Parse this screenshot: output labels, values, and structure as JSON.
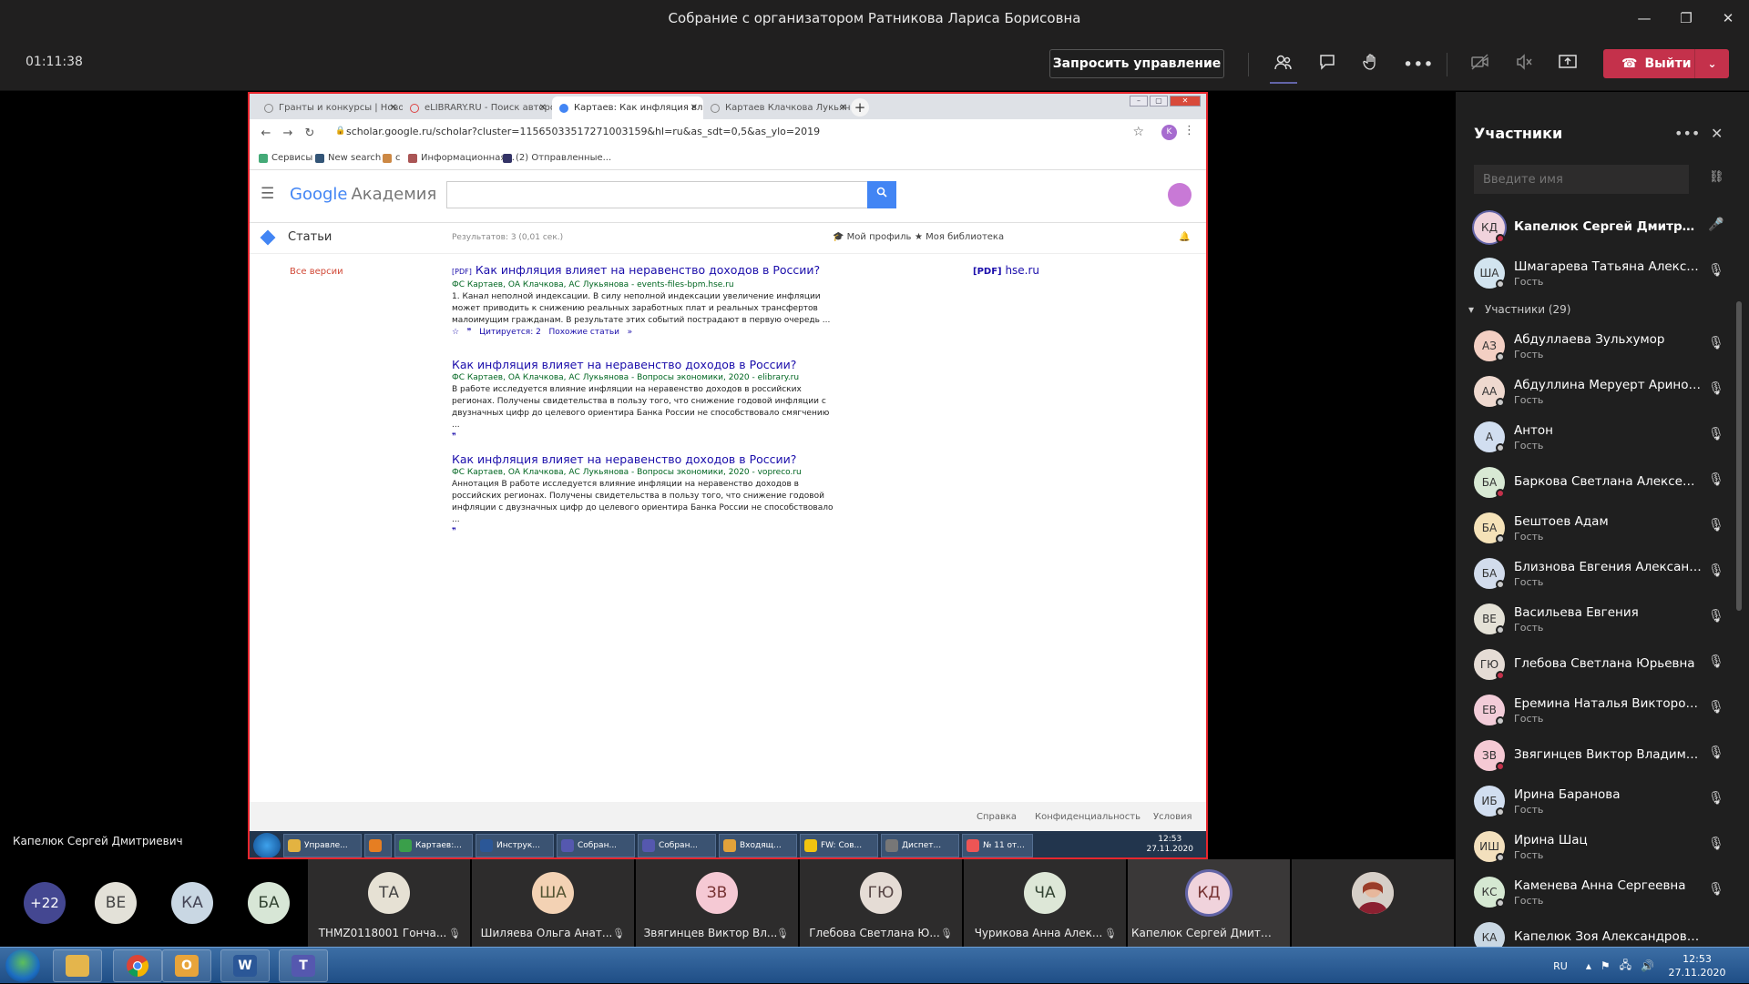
{
  "window": {
    "title": "Собрание с организатором Ратникова Лариса Борисовна",
    "min": "—",
    "max": "❐",
    "close": "✕"
  },
  "toolbar": {
    "timer": "01:11:38",
    "request_control": "Запросить управление",
    "leave_label": "Выйти"
  },
  "browser": {
    "tabs": [
      {
        "label": "Гранты и конкурсы | Новости"
      },
      {
        "label": "eLIBRARY.RU - Поиск авторов"
      },
      {
        "label": "Картаев: Как инфляция влияет"
      },
      {
        "label": "Картаев Клачкова Лукьянова р"
      }
    ],
    "url": "scholar.google.ru/scholar?cluster=11565033517271003159&hl=ru&as_sdt=0,5&as_ylo=2019",
    "profile_letter": "K",
    "bookmarks": [
      "Сервисы",
      "New search",
      "с",
      "Информационная...",
      "(2) Отправленные..."
    ]
  },
  "scholar": {
    "logo_g": "Google",
    "logo_suffix": "Академия",
    "search_value": "",
    "articles": "Статьи",
    "results_count": "Результатов: 3 (0,01 сек.)",
    "my_profile": "Мой профиль",
    "my_library": "Моя библиотека",
    "all_versions": "Все версии",
    "results": [
      {
        "tag": "[PDF]",
        "title": "Как инфляция влияет на неравенство доходов в России?",
        "authors": "ФС Картаев, ОА Клачкова, АС Лукьянова - events-files-bpm.hse.ru",
        "snippet1": "1. Канал неполной индексации. В силу неполной индексации увеличение инфляции",
        "snippet2": "может приводить к снижению реальных заработных плат и реальных трансфертов",
        "snippet3": "малоимущим гражданам. В результате этих событий пострадают в первую очередь ...",
        "cited": "Цитируется: 2",
        "related": "Похожие статьи"
      },
      {
        "title": "Как инфляция влияет на неравенство доходов в России?",
        "authors": "ФС Картаев, ОА Клачкова, АС Лукьянова - Вопросы экономики, 2020 - elibrary.ru",
        "snippet1": "В работе исследуется влияние инфляции на неравенство доходов в российских",
        "snippet2": "регионах. Получены свидетельства в пользу того, что снижение годовой инфляции с",
        "snippet3": "двузначных цифр до целевого ориентира Банка России не способствовало смягчению ..."
      },
      {
        "title": "Как инфляция влияет на неравенство доходов в России?",
        "authors": "ФС Картаев, ОА Клачкова, АС Лукьянова - Вопросы экономики, 2020 - vopreco.ru",
        "snippet1": "Аннотация В работе исследуется влияние инфляции на неравенство доходов в",
        "snippet2": "российских регионах. Получены свидетельства в пользу того, что снижение годовой",
        "snippet3": "инфляции с двузначных цифр до целевого ориентира Банка России не способствовало ..."
      }
    ],
    "pdf_side_tag": "[PDF]",
    "pdf_side_host": "hse.ru",
    "footer": [
      "Справка",
      "Конфиденциальность",
      "Условия"
    ]
  },
  "inner_taskbar": {
    "items": [
      "Управле...",
      "",
      "Картаев:...",
      "Инструк...",
      "Собран...",
      "Собран...",
      "Входящ...",
      "FW: Сов...",
      "Диспет...",
      "№ 11 от..."
    ],
    "time": "12:53",
    "date": "27.11.2020"
  },
  "presenter_name": "Капелюк Сергей Дмитриевич",
  "strip": {
    "more": "+22",
    "minis": [
      "ВЕ",
      "КА",
      "БА"
    ],
    "tiles": [
      {
        "initials": "ТА",
        "name": "THMZ0118001 Гонча..."
      },
      {
        "initials": "ША",
        "name": "Шиляева Ольга Анат..."
      },
      {
        "initials": "ЗВ",
        "name": "Звягинцев Виктор Вл..."
      },
      {
        "initials": "ГЮ",
        "name": "Глебова Светлана Ю..."
      },
      {
        "initials": "ЧА",
        "name": "Чурикова Анна Алек..."
      },
      {
        "initials": "КД",
        "name": "Капелюк Сергей Дмитри..."
      }
    ]
  },
  "panel": {
    "title": "Участники",
    "search_placeholder": "Введите имя",
    "top": [
      {
        "initials": "КД",
        "name": "Капелюк Сергей Дмитриев...",
        "role": ""
      },
      {
        "initials": "ША",
        "name": "Шмагарева Татьяна Алексан...",
        "role": "Гость"
      }
    ],
    "group_label": "Участники (29)",
    "people": [
      {
        "initials": "АЗ",
        "name": "Абдуллаева Зульхумор",
        "role": "Гость"
      },
      {
        "initials": "АА",
        "name": "Абдуллина Меруерт Аринов...",
        "role": "Гость"
      },
      {
        "initials": "А",
        "name": "Антон",
        "role": "Гость"
      },
      {
        "initials": "БА",
        "name": "Баркова Светлана Алексеевна",
        "role": ""
      },
      {
        "initials": "БА",
        "name": "Бештоев Адам",
        "role": "Гость"
      },
      {
        "initials": "БА",
        "name": "Близнова Евгения Александ...",
        "role": "Гость"
      },
      {
        "initials": "ВЕ",
        "name": "Васильева Евгения",
        "role": "Гость"
      },
      {
        "initials": "ГЮ",
        "name": "Глебова Светлана Юрьевна",
        "role": ""
      },
      {
        "initials": "ЕВ",
        "name": "Еремина Наталья Викторовна",
        "role": "Гость"
      },
      {
        "initials": "ЗВ",
        "name": "Звягинцев Виктор Владимир...",
        "role": ""
      },
      {
        "initials": "ИБ",
        "name": "Ирина Баранова",
        "role": "Гость"
      },
      {
        "initials": "ИШ",
        "name": "Ирина Шац",
        "role": "Гость"
      },
      {
        "initials": "КС",
        "name": "Каменева Анна Сергеевна",
        "role": "Гость"
      },
      {
        "initials": "КА",
        "name": "Капелюк Зоя Александровна",
        "role": ""
      }
    ]
  },
  "taskbar": {
    "lang": "RU",
    "time": "12:53",
    "date": "27.11.2020"
  }
}
